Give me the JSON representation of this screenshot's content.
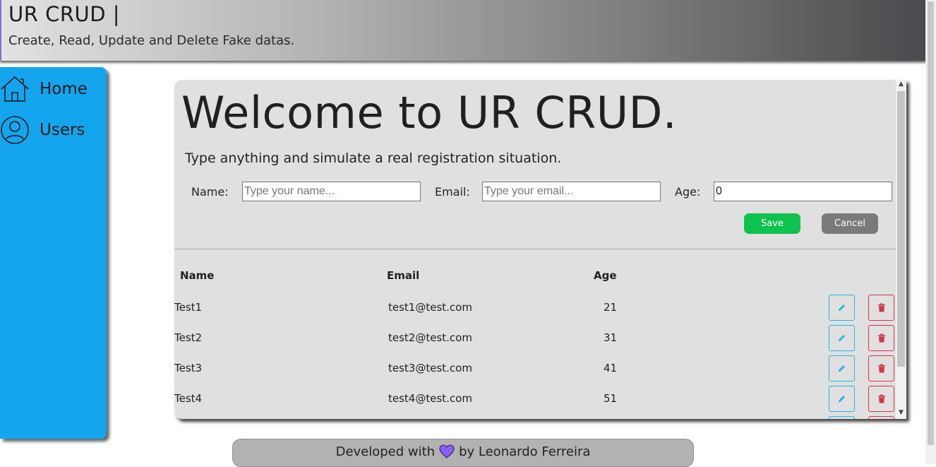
{
  "header": {
    "title": "UR CRUD |",
    "subtitle": "Create, Read, Update and Delete Fake datas."
  },
  "sidebar": {
    "items": [
      {
        "label": "Home",
        "icon": "home-icon"
      },
      {
        "label": "Users",
        "icon": "user-icon"
      }
    ]
  },
  "main": {
    "heading": "Welcome to UR CRUD.",
    "lead": "Type anything and simulate a real registration situation.",
    "form": {
      "name_label": "Name:",
      "name_placeholder": "Type your name...",
      "email_label": "Email:",
      "email_placeholder": "Type your email...",
      "age_label": "Age:",
      "age_value": "0",
      "save_label": "Save",
      "cancel_label": "Cancel"
    },
    "table": {
      "headers": [
        "Name",
        "Email",
        "Age"
      ],
      "rows": [
        {
          "name": "Test1",
          "email": "test1@test.com",
          "age": "21"
        },
        {
          "name": "Test2",
          "email": "test2@test.com",
          "age": "31"
        },
        {
          "name": "Test3",
          "email": "test3@test.com",
          "age": "41"
        },
        {
          "name": "Test4",
          "email": "test4@test.com",
          "age": "51"
        }
      ]
    }
  },
  "footer": {
    "before": "Developed with",
    "after": "by Leonardo Ferreira"
  },
  "colors": {
    "sidebar": "#13a5ee",
    "save": "#0ec250",
    "cancel": "#7a7a7a",
    "edit": "#21b6e4",
    "delete": "#d5344a",
    "heart": "#8b5cf6"
  }
}
